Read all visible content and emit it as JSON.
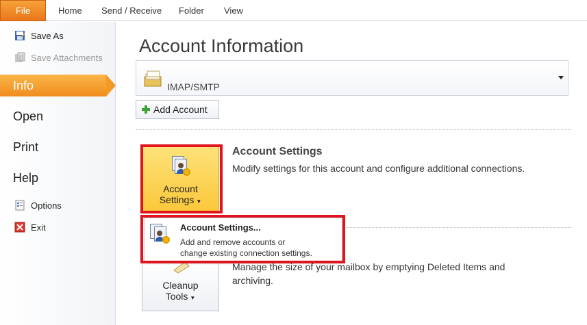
{
  "ribbon": {
    "file_label": "File",
    "tabs": [
      "Home",
      "Send / Receive",
      "Folder",
      "View"
    ]
  },
  "nav": {
    "save_as": "Save As",
    "save_attachments": "Save Attachments",
    "info": "Info",
    "open": "Open",
    "print": "Print",
    "help": "Help",
    "options": "Options",
    "exit": "Exit"
  },
  "main": {
    "title": "Account Information",
    "account_selector": {
      "value": "IMAP/SMTP"
    },
    "add_account_label": "Add Account",
    "account_settings": {
      "button_line1": "Account",
      "button_line2": "Settings",
      "heading": "Account Settings",
      "description": "Modify settings for this account and configure additional connections."
    },
    "cleanup": {
      "button_line1": "Cleanup",
      "button_line2": "Tools",
      "description_line1": "Manage the size of your mailbox by emptying Deleted Items and",
      "description_line2": "archiving."
    },
    "menu": {
      "item_title": "Account Settings...",
      "item_desc_line1": "Add and remove accounts or",
      "item_desc_line2": "change existing connection settings."
    }
  },
  "colors": {
    "file_tab": "#e9761a",
    "active_nav": "#f29a26",
    "highlight_button": "#fcc83b",
    "annotation_red": "#e0141e"
  }
}
